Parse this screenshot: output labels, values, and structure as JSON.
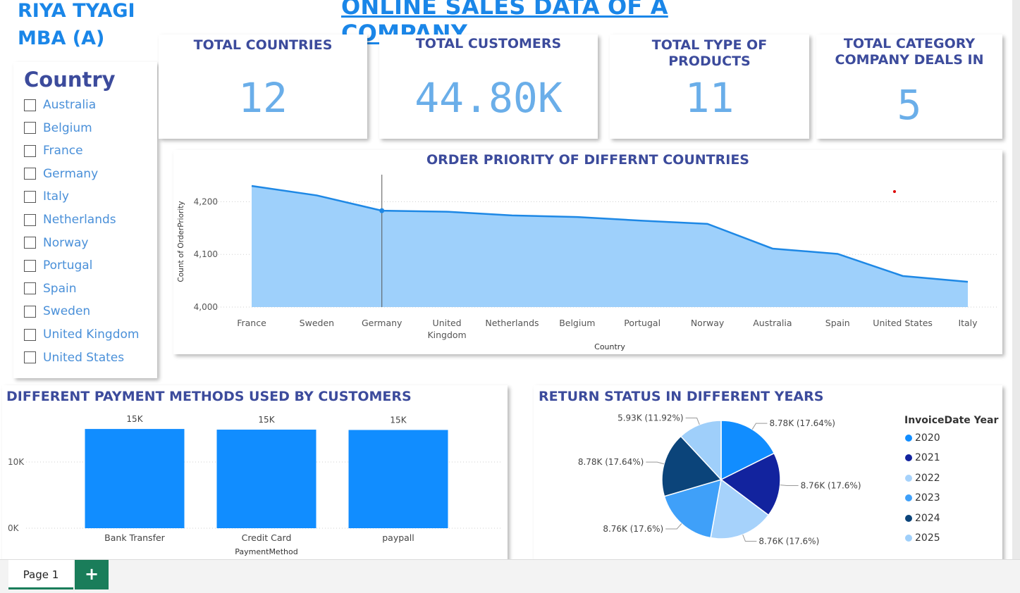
{
  "header": {
    "author_line1": "RIYA TYAGI",
    "author_line2": "MBA (A)",
    "title": "ONLINE SALES DATA OF A COMPANY"
  },
  "slicer": {
    "title": "Country",
    "items": [
      "Australia",
      "Belgium",
      "France",
      "Germany",
      "Italy",
      "Netherlands",
      "Norway",
      "Portugal",
      "Spain",
      "Sweden",
      "United Kingdom",
      "United States"
    ]
  },
  "kpis": [
    {
      "title": "TOTAL COUNTRIES",
      "value": "12"
    },
    {
      "title": "TOTAL CUSTOMERS",
      "value": "44.80K"
    },
    {
      "title": "TOTAL TYPE OF PRODUCTS",
      "value": "11"
    },
    {
      "title": "TOTAL CATEGORY COMPANY DEALS IN",
      "value": "5"
    }
  ],
  "colors": {
    "title_blue": "#1a86e8",
    "heading_navy": "#3c4b9c",
    "area_fill": "#9ed0fb",
    "area_line": "#1e88e5",
    "bar": "#118dff",
    "tab_green": "#1a7d5a"
  },
  "chart_data": [
    {
      "type": "area",
      "title": "ORDER PRIORITY OF DIFFERNT COUNTRIES",
      "xlabel": "Country",
      "ylabel": "Count of OrderPriority",
      "categories": [
        "France",
        "Sweden",
        "Germany",
        "United Kingdom",
        "Netherlands",
        "Belgium",
        "Portugal",
        "Norway",
        "Australia",
        "Spain",
        "United States",
        "Italy"
      ],
      "category_labels": [
        "France",
        "Sweden",
        "Germany",
        "United\nKingdom",
        "Netherlands",
        "Belgium",
        "Portugal",
        "Norway",
        "Australia",
        "Spain",
        "United States",
        "Italy"
      ],
      "values": [
        4230,
        4212,
        4183,
        4181,
        4174,
        4171,
        4164,
        4158,
        4111,
        4101,
        4059,
        4048
      ],
      "ylim": [
        4000,
        4250
      ],
      "yticks": [
        4000,
        4100,
        4200
      ],
      "ytick_labels": [
        "4,000",
        "4,100",
        "4,200"
      ],
      "highlight_category": "Germany",
      "grid": true
    },
    {
      "type": "bar",
      "title": "DIFFERENT PAYMENT METHODS USED BY CUSTOMERS",
      "xlabel": "PaymentMethod",
      "ylabel": "",
      "categories": [
        "Bank Transfer",
        "Credit Card",
        "paypall"
      ],
      "values": [
        15000,
        14900,
        14850
      ],
      "data_labels": [
        "15K",
        "15K",
        "15K"
      ],
      "ylim": [
        0,
        16500
      ],
      "yticks": [
        0,
        10000
      ],
      "ytick_labels": [
        "0K",
        "10K"
      ],
      "grid": true
    },
    {
      "type": "pie",
      "title": "RETURN STATUS IN DIFFERENT YEARS",
      "legend_title": "InvoiceDate Year",
      "legend_position": "right",
      "slices": [
        {
          "name": "2020",
          "value": 8.78,
          "percent": 17.64,
          "label": "8.78K (17.64%)",
          "color": "#118dff"
        },
        {
          "name": "2021",
          "value": 8.76,
          "percent": 17.6,
          "label": "8.76K (17.6%)",
          "color": "#12239e"
        },
        {
          "name": "2022",
          "value": 8.76,
          "percent": 17.6,
          "label": "8.76K (17.6%)",
          "color": "#a6d2fb"
        },
        {
          "name": "2023",
          "value": 8.76,
          "percent": 17.6,
          "label": "8.76K (17.6%)",
          "color": "#3fa0f9"
        },
        {
          "name": "2024",
          "value": 8.78,
          "percent": 17.64,
          "label": "8.78K (17.64%)",
          "color": "#0b447a"
        },
        {
          "name": "2025",
          "value": 5.93,
          "percent": 11.92,
          "label": "5.93K (11.92%)",
          "color": "#9fcffa"
        }
      ]
    }
  ],
  "tabs": {
    "page_label": "Page 1",
    "add_label": "+"
  }
}
